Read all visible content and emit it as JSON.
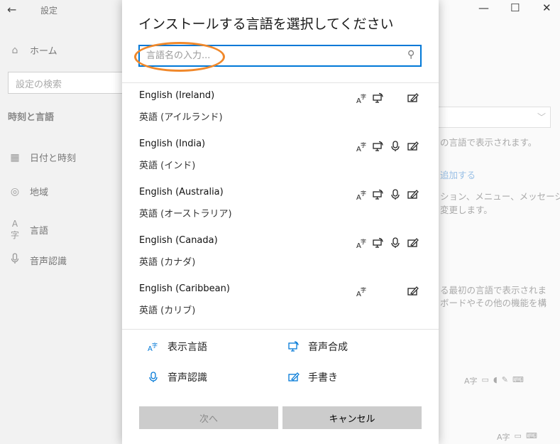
{
  "background": {
    "window_title": "設定",
    "back_icon": "←",
    "nav_home": "ホーム",
    "search_placeholder": "設定の検索",
    "section_title": "時刻と言語",
    "nav_items": [
      "日付と時刻",
      "地域",
      "言語",
      "音声認識"
    ],
    "window_controls": [
      "—",
      "☐",
      "✕"
    ],
    "right_texts": [
      "の言語で表示されます。",
      "追加する",
      "ション、メニュー、メッセージ、",
      "変更します。",
      "る最初の言語で表示されま",
      "ボードやその他の機能を構"
    ]
  },
  "dialog": {
    "title": "インストールする言語を選択してください",
    "search_placeholder": "言語名の入力...",
    "languages": [
      {
        "name": "English (Ireland)",
        "native": "英語 (アイルランド)",
        "features": [
          "display",
          "tts",
          "handwriting"
        ]
      },
      {
        "name": "English (India)",
        "native": "英語 (インド)",
        "features": [
          "display",
          "tts",
          "speech",
          "handwriting"
        ]
      },
      {
        "name": "English (Australia)",
        "native": "英語 (オーストラリア)",
        "features": [
          "display",
          "tts",
          "speech",
          "handwriting"
        ]
      },
      {
        "name": "English (Canada)",
        "native": "英語 (カナダ)",
        "features": [
          "display",
          "tts",
          "speech",
          "handwriting"
        ]
      },
      {
        "name": "English (Caribbean)",
        "native": "英語 (カリブ)",
        "features": [
          "display",
          "handwriting"
        ]
      }
    ],
    "legend": {
      "display": "表示言語",
      "tts": "音声合成",
      "speech": "音声認識",
      "handwriting": "手書き"
    },
    "buttons": {
      "next": "次へ",
      "cancel": "キャンセル"
    }
  },
  "colors": {
    "accent": "#0078d7",
    "highlight_ring": "#f0882a",
    "button_bg": "#cccccc"
  }
}
